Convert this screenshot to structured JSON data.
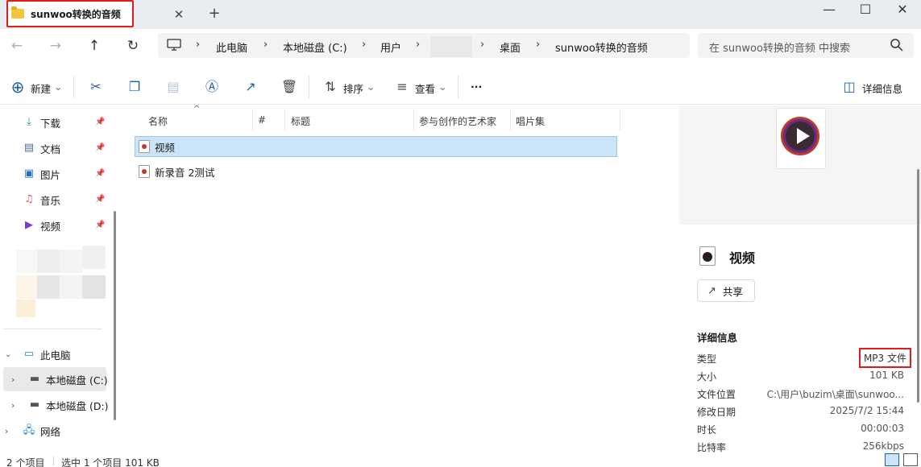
{
  "tab": {
    "title": "sunwoo转换的音频",
    "close": "✕",
    "add": "+"
  },
  "window": {
    "minimize": "—",
    "maximize": "☐",
    "close": "✕"
  },
  "nav": {
    "back": "←",
    "forward": "→",
    "up": "↑",
    "refresh": "↻"
  },
  "breadcrumb": [
    "此电脑",
    "本地磁盘 (C:)",
    "用户",
    "桌面",
    "sunwoo转换的音频"
  ],
  "search": {
    "placeholder": "在 sunwoo转换的音频 中搜索"
  },
  "toolbar": {
    "new_label": "新建",
    "sort_label": "排序",
    "view_label": "查看",
    "more_label": "···",
    "details_label": "详细信息"
  },
  "sidebar": {
    "quick_access": [
      {
        "label": "下载",
        "icon": "download-icon"
      },
      {
        "label": "文档",
        "icon": "document-icon"
      },
      {
        "label": "图片",
        "icon": "picture-icon"
      },
      {
        "label": "音乐",
        "icon": "music-icon"
      },
      {
        "label": "视频",
        "icon": "video-icon"
      }
    ],
    "this_pc": "此电脑",
    "drive_c": "本地磁盘 (C:)",
    "drive_d": "本地磁盘 (D:)",
    "network": "网络"
  },
  "columns": [
    "名称",
    "#",
    "标题",
    "参与创作的艺术家",
    "唱片集"
  ],
  "files": [
    {
      "name": "视频",
      "selected": true
    },
    {
      "name": "新录音 2测试",
      "selected": false
    }
  ],
  "details": {
    "name": "视频",
    "share_label": "共享",
    "section_title": "详细信息",
    "props": [
      {
        "label": "类型",
        "value": "MP3 文件"
      },
      {
        "label": "大小",
        "value": "101 KB"
      },
      {
        "label": "文件位置",
        "value": "C:\\用户\\buzim\\桌面\\sunwoo..."
      },
      {
        "label": "修改日期",
        "value": "2025/7/2 15:44"
      },
      {
        "label": "时长",
        "value": "00:00:03"
      },
      {
        "label": "比特率",
        "value": "256kbps"
      }
    ]
  },
  "status": {
    "count": "2 个项目",
    "selection": "选中 1 个项目  101 KB"
  },
  "colors": {
    "accent": "#1f5fa8",
    "selection": "#cce4f7",
    "highlight_box": "#e01b1b"
  }
}
